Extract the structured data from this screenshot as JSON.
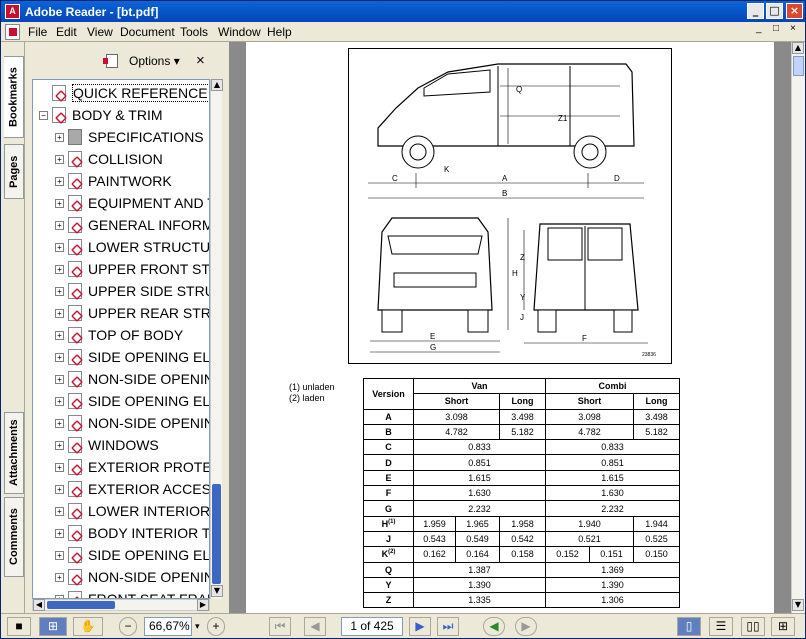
{
  "window": {
    "title": "Adobe Reader - [bt.pdf]",
    "minimize": "_",
    "maximize": "□",
    "close": "×"
  },
  "menu": {
    "items": [
      "File",
      "Edit",
      "View",
      "Document",
      "Tools",
      "Window",
      "Help"
    ],
    "doc_min": "_",
    "doc_restore": "□",
    "doc_close": "×"
  },
  "side_tabs": {
    "bookmarks": "Bookmarks",
    "pages": "Pages",
    "attachments": "Attachments",
    "comments": "Comments"
  },
  "panel": {
    "options_label": "Options ▾",
    "close": "×"
  },
  "bookmarks": [
    {
      "label": "QUICK REFERENCE INFO",
      "level": 0,
      "expander": ""
    },
    {
      "label": "BODY & TRIM",
      "level": 0,
      "expander": "−"
    },
    {
      "label": "SPECIFICATIONS",
      "level": 1,
      "expander": "+",
      "icon": "grey"
    },
    {
      "label": "COLLISION",
      "level": 1,
      "expander": "+"
    },
    {
      "label": "PAINTWORK",
      "level": 1,
      "expander": "+"
    },
    {
      "label": "EQUIPMENT AND TOOLS",
      "level": 1,
      "expander": "+"
    },
    {
      "label": "GENERAL INFORMATION",
      "level": 1,
      "expander": "+"
    },
    {
      "label": "LOWER STRUCTURE",
      "level": 1,
      "expander": "+"
    },
    {
      "label": "UPPER FRONT STRUCTURE",
      "level": 1,
      "expander": "+"
    },
    {
      "label": "UPPER SIDE STRUCTURE",
      "level": 1,
      "expander": "+"
    },
    {
      "label": "UPPER REAR STRUCTURE",
      "level": 1,
      "expander": "+"
    },
    {
      "label": "TOP OF BODY",
      "level": 1,
      "expander": "+"
    },
    {
      "label": "SIDE OPENING ELEMENTS",
      "level": 1,
      "expander": "+"
    },
    {
      "label": "NON-SIDE OPENING ELEMENTS",
      "level": 1,
      "expander": "+"
    },
    {
      "label": "SIDE OPENING ELEMENTS",
      "level": 1,
      "expander": "+"
    },
    {
      "label": "NON-SIDE OPENING ELEMENTS",
      "level": 1,
      "expander": "+"
    },
    {
      "label": "WINDOWS",
      "level": 1,
      "expander": "+"
    },
    {
      "label": "EXTERIOR PROTECTION",
      "level": 1,
      "expander": "+"
    },
    {
      "label": "EXTERIOR ACCESSORIES",
      "level": 1,
      "expander": "+"
    },
    {
      "label": "LOWER INTERIOR AND",
      "level": 1,
      "expander": "+"
    },
    {
      "label": "BODY INTERIOR TRIM",
      "level": 1,
      "expander": "+"
    },
    {
      "label": "SIDE OPENING ELEMENTS",
      "level": 1,
      "expander": "+"
    },
    {
      "label": "NON-SIDE OPENING",
      "level": 1,
      "expander": "+"
    },
    {
      "label": "FRONT SEAT FRAMES",
      "level": 1,
      "expander": "+"
    }
  ],
  "document": {
    "diagram_labels": {
      "q": "Q",
      "z1": "Z1",
      "c": "C",
      "a": "A",
      "d": "D",
      "b": "B",
      "k": "K",
      "e": "E",
      "g": "G",
      "f": "F",
      "h": "H",
      "z": "Z",
      "y": "Y",
      "j": "J",
      "ref": "23836"
    },
    "footnotes": [
      "(1) unladen",
      "(2) laden"
    ],
    "table": {
      "header_version": "Version",
      "header_van": "Van",
      "header_combi": "Combi",
      "sub_headers": [
        "Short",
        "Long",
        "Short",
        "Long"
      ],
      "rows": [
        {
          "label": "A",
          "cells": [
            "3.098",
            "3.498",
            "3.098",
            "3.498"
          ]
        },
        {
          "label": "B",
          "cells": [
            "4.782",
            "5.182",
            "4.782",
            "5.182"
          ]
        },
        {
          "label": "C",
          "van": "0.833",
          "combi": "0.833"
        },
        {
          "label": "D",
          "van": "0.851",
          "combi": "0.851"
        },
        {
          "label": "E",
          "van": "1.615",
          "combi": "1.615"
        },
        {
          "label": "F",
          "van": "1.630",
          "combi": "1.630"
        },
        {
          "label": "G",
          "van": "2.232",
          "combi": "2.232"
        },
        {
          "label": "H",
          "sup": "(1)",
          "van3": [
            "1.959",
            "1.965",
            "1.958"
          ],
          "combi_merged": "1.940",
          "combi_last": "1.944"
        },
        {
          "label": "J",
          "van3": [
            "0.543",
            "0.549",
            "0.542"
          ],
          "combi_merged": "0.521",
          "combi_last": "0.525"
        },
        {
          "label": "K",
          "sup": "(2)",
          "van3": [
            "0.162",
            "0.164",
            "0.158"
          ],
          "combi3": [
            "0.152",
            "0.151",
            "0.150"
          ]
        },
        {
          "label": "Q",
          "van": "1.387",
          "combi": "1.369"
        },
        {
          "label": "Y",
          "van": "1.390",
          "combi": "1.390"
        },
        {
          "label": "Z",
          "van": "1.335",
          "combi": "1.306"
        }
      ]
    }
  },
  "statusbar": {
    "zoom": "66,67%",
    "page": "1 of 425",
    "zoom_out": "−",
    "zoom_in": "+",
    "zoom_menu": "▾"
  },
  "colors": {
    "titlebar": "#0a5ccf",
    "pdf_red": "#c8102e",
    "doc_bg": "#8a8a8a"
  }
}
